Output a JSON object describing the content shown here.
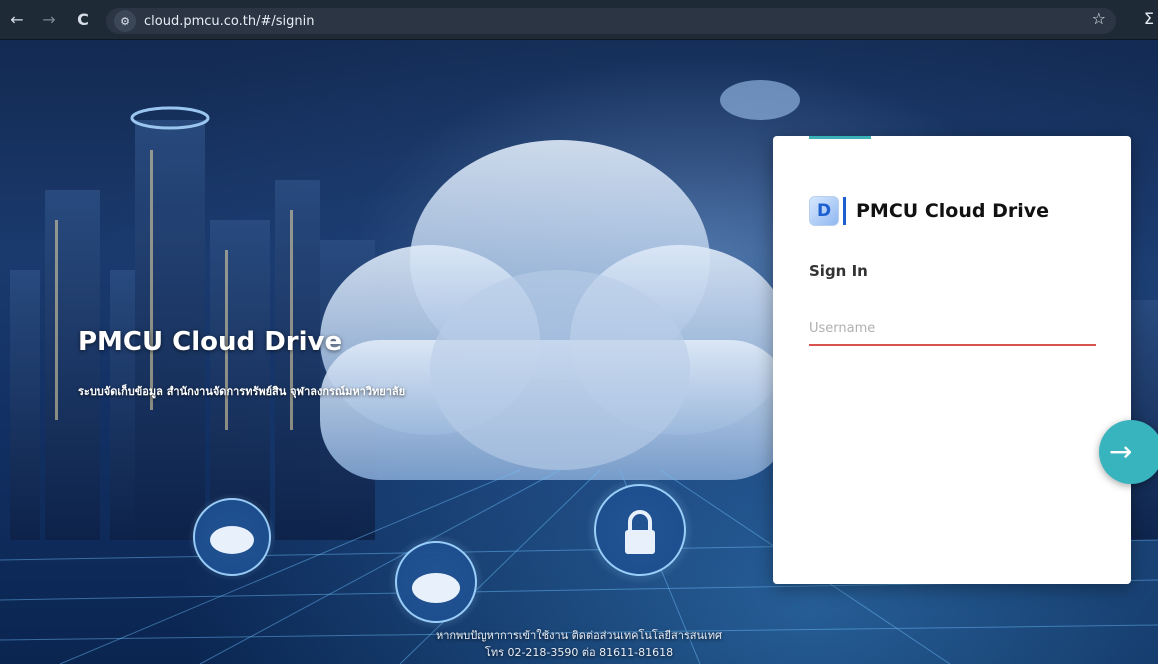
{
  "browser": {
    "back_icon": "←",
    "forward_icon": "→",
    "reload_icon": "C",
    "site_info_icon": "⚙",
    "url": "cloud.pmcu.co.th/#/signin",
    "star_icon": "☆",
    "extension_icon": "Σ"
  },
  "hero": {
    "title": "PMCU Cloud Drive",
    "subtitle": "ระบบจัดเก็บข้อมูล สำนักงานจัดการทรัพย์สิน จุฬาลงกรณ์มหาวิทยาลัย"
  },
  "login": {
    "logo_letter": "D",
    "app_name": "PMCU Cloud Drive",
    "heading": "Sign In",
    "username_placeholder": "Username",
    "username_value": "",
    "submit_icon": "→",
    "accent_color": "#3bb0b7",
    "error_color": "#d9534f",
    "button_color": "#38b4be"
  },
  "footer": {
    "line1": "หากพบปัญหาการเข้าใช้งาน ติดต่อส่วนเทคโนโลยีสารสนเทศ",
    "line2": "โทร 02-218-3590 ต่อ 81611-81618"
  }
}
